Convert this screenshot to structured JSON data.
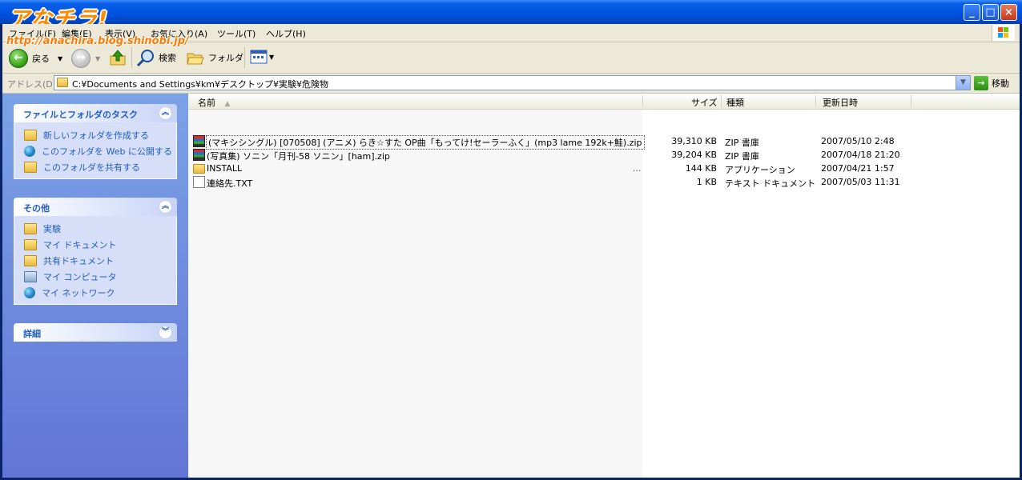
{
  "window": {
    "logo_text": "アなチラ!",
    "logo_url": "http://anachira.blog.shinobi.jp/"
  },
  "menu": [
    {
      "label": "ファイル(F)"
    },
    {
      "label": "編集(E)"
    },
    {
      "label": "表示(V)"
    },
    {
      "label": "お気に入り(A)"
    },
    {
      "label": "ツール(T)"
    },
    {
      "label": "ヘルプ(H)"
    }
  ],
  "toolbar": {
    "back_label": "戻る",
    "search_label": "検索",
    "folders_label": "フォルダ"
  },
  "address": {
    "label": "アドレス(D)",
    "path": "C:¥Documents and Settings¥km¥デスクトップ¥実験¥危険物",
    "go_label": "移動"
  },
  "tasks": {
    "file_folder_title": "ファイルとフォルダのタスク",
    "file_folder_items": [
      {
        "label": "新しいフォルダを作成する"
      },
      {
        "label": "このフォルダを Web に公開する"
      },
      {
        "label": "このフォルダを共有する"
      }
    ],
    "other_title": "その他",
    "other_items": [
      {
        "label": "実験"
      },
      {
        "label": "マイ ドキュメント"
      },
      {
        "label": "共有ドキュメント"
      },
      {
        "label": "マイ コンピュータ"
      },
      {
        "label": "マイ ネットワーク"
      }
    ],
    "details_title": "詳細"
  },
  "columns": {
    "name": "名前",
    "size": "サイズ",
    "type": "種類",
    "modified": "更新日時"
  },
  "files": [
    {
      "name": "(マキシシングル) [070508] (アニメ) らき☆すた OP曲「もってけ!セーラーふく」(mp3 lame 192k+鮭).zip",
      "size": "39,310 KB",
      "type": "ZIP 書庫",
      "modified": "2007/05/10 2:48",
      "icon": "zip-archive-icon"
    },
    {
      "name": "(写真集) ソニン「月刊-58 ソニン」[ham].zip",
      "size": "39,204 KB",
      "type": "ZIP 書庫",
      "modified": "2007/04/18 21:20",
      "icon": "zip-archive-icon"
    },
    {
      "name": "INSTALL",
      "size": "144 KB",
      "type": "アプリケーション",
      "modified": "2007/04/21 1:57",
      "icon": "folder-icon",
      "ellipsis": "..."
    },
    {
      "name": "連絡先.TXT",
      "size": "1 KB",
      "type": "テキスト ドキュメント",
      "modified": "2007/05/03 11:31",
      "icon": "text-file-icon"
    }
  ]
}
